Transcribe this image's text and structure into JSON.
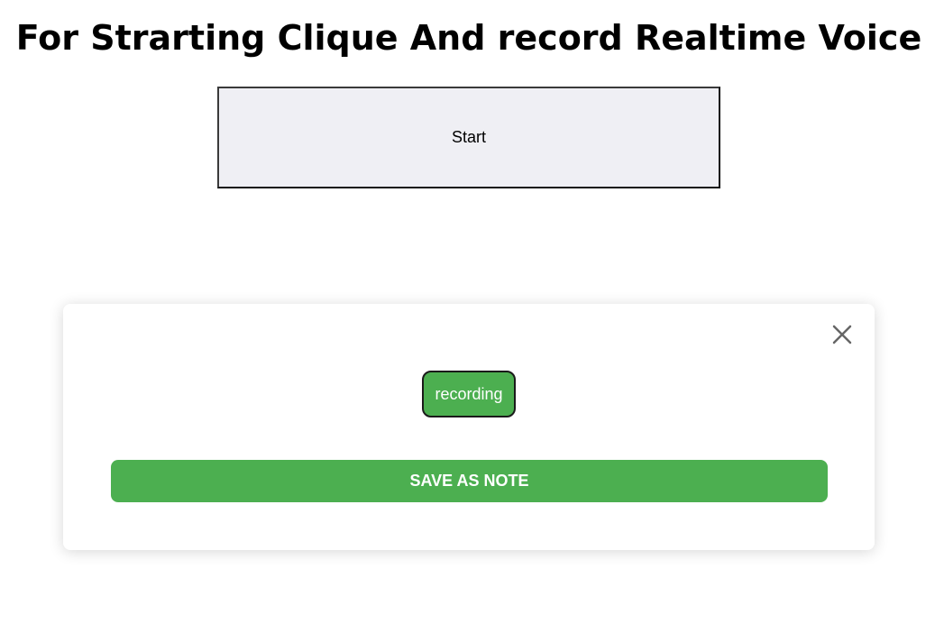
{
  "page": {
    "title": "For Strarting Clique And record Realtime Voice"
  },
  "controls": {
    "start_label": "Start"
  },
  "modal": {
    "close_icon": "close-icon",
    "recording_label": "recording",
    "save_label": "SAVE AS NOTE"
  },
  "colors": {
    "accent_green": "#4caf50",
    "start_button_bg": "#efeff4",
    "close_icon": "#666666"
  }
}
